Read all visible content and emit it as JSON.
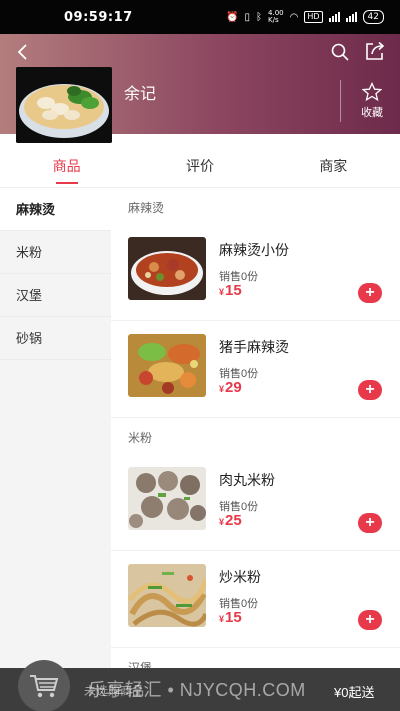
{
  "status_bar": {
    "time": "09:59:17",
    "network_speed": "4.00\nK/s",
    "battery": "42",
    "hd_label": "HD"
  },
  "header": {
    "shop_name": "余记",
    "favorite_label": "收藏"
  },
  "tabs": [
    {
      "label": "商品",
      "active": true
    },
    {
      "label": "评价",
      "active": false
    },
    {
      "label": "商家",
      "active": false
    }
  ],
  "sidebar": {
    "items": [
      {
        "label": "麻辣烫",
        "active": true
      },
      {
        "label": "米粉",
        "active": false
      },
      {
        "label": "汉堡",
        "active": false
      },
      {
        "label": "砂锅",
        "active": false
      }
    ]
  },
  "sections": [
    {
      "title": "麻辣烫",
      "items": [
        {
          "name": "麻辣烫小份",
          "sales": "销售0份",
          "currency": "¥",
          "price": "15"
        },
        {
          "name": "猪手麻辣烫",
          "sales": "销售0份",
          "currency": "¥",
          "price": "29"
        }
      ]
    },
    {
      "title": "米粉",
      "items": [
        {
          "name": "肉丸米粉",
          "sales": "销售0份",
          "currency": "¥",
          "price": "25"
        },
        {
          "name": "炒米粉",
          "sales": "销售0份",
          "currency": "¥",
          "price": "15"
        }
      ]
    },
    {
      "title": "汉堡",
      "items": []
    }
  ],
  "bottom_bar": {
    "cart_text": "未选购商品",
    "min_order": "¥0起送",
    "watermark": "乐享轻汇 • NJYCQH.COM"
  },
  "colors": {
    "accent": "#e7394a",
    "header_start": "#b37d7d",
    "header_end": "#6d2a4a"
  }
}
